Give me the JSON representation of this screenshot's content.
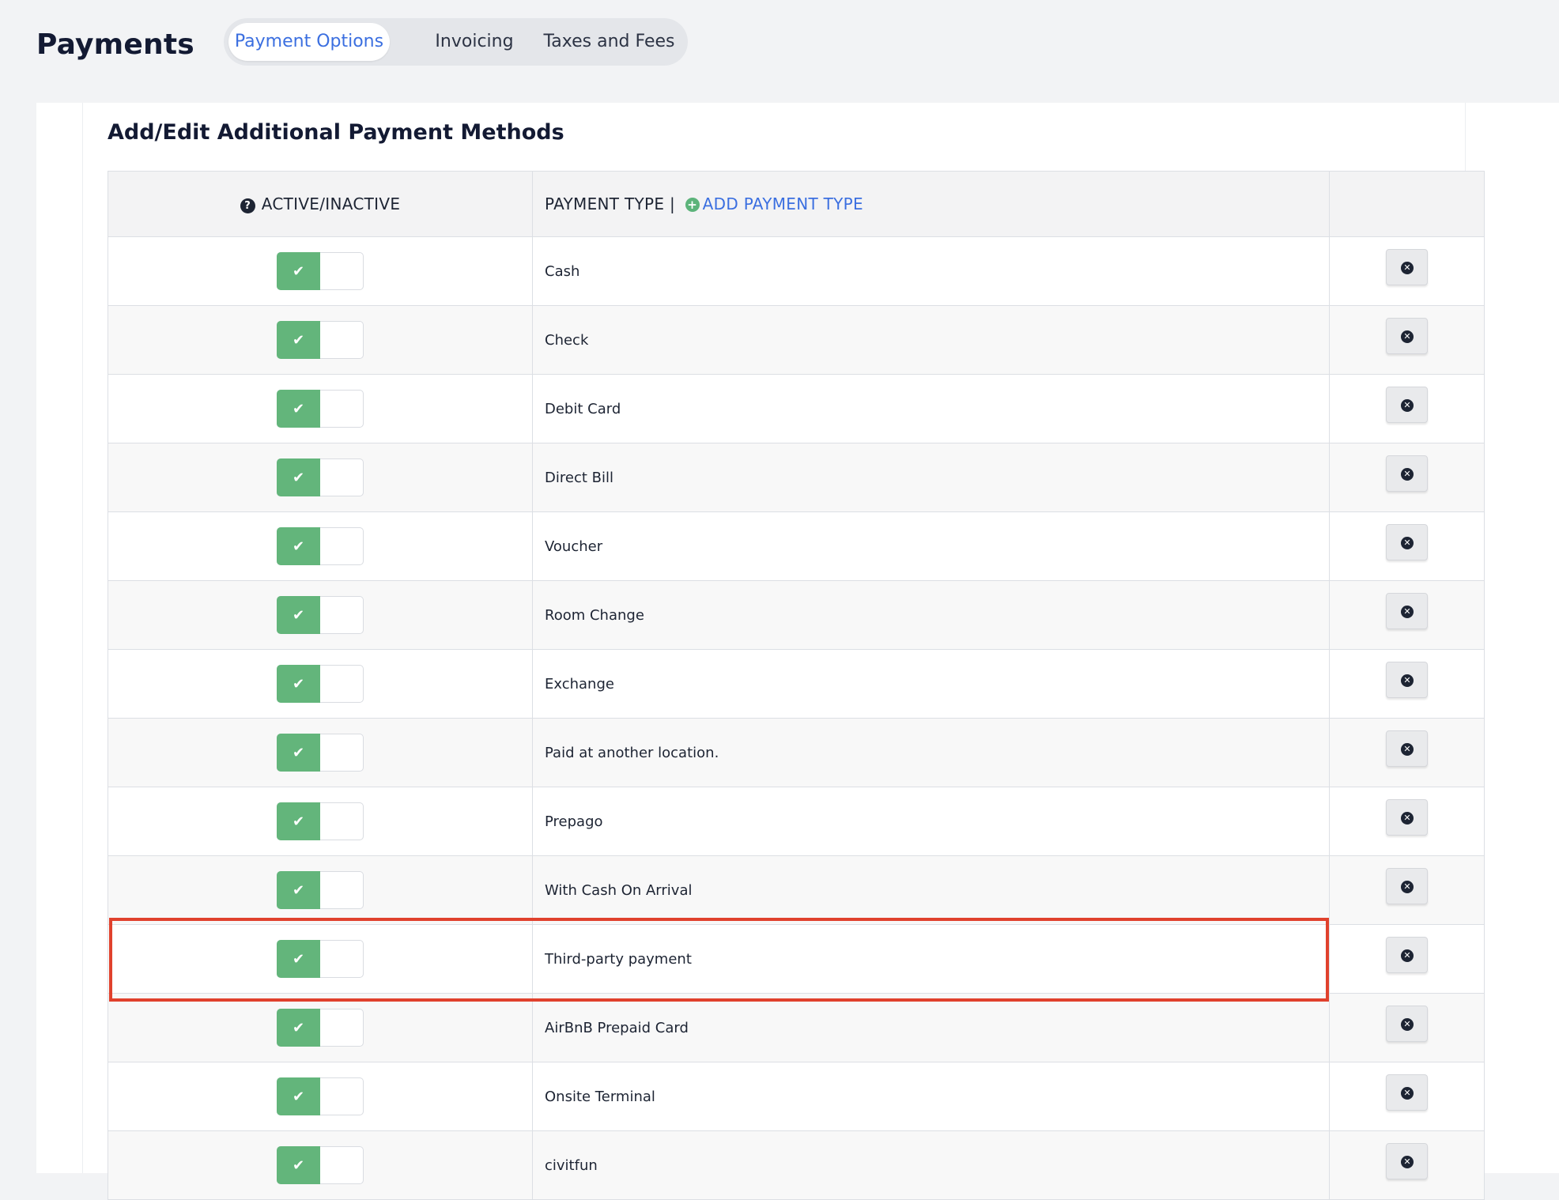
{
  "header": {
    "title": "Payments",
    "tabs": [
      {
        "label": "Payment Options",
        "active": true
      },
      {
        "label": "Invoicing",
        "active": false
      },
      {
        "label": "Taxes and Fees",
        "active": false
      }
    ]
  },
  "section": {
    "title": "Add/Edit Additional Payment Methods",
    "columns": {
      "active": "ACTIVE/INACTIVE",
      "type": "PAYMENT TYPE |",
      "add_type": "ADD PAYMENT TYPE"
    },
    "rows": [
      {
        "name": "Cash",
        "active": true
      },
      {
        "name": "Check",
        "active": true
      },
      {
        "name": "Debit Card",
        "active": true
      },
      {
        "name": "Direct Bill",
        "active": true
      },
      {
        "name": "Voucher",
        "active": true
      },
      {
        "name": "Room Change",
        "active": true
      },
      {
        "name": "Exchange",
        "active": true
      },
      {
        "name": "Paid at another location.",
        "active": true
      },
      {
        "name": "Prepago",
        "active": true
      },
      {
        "name": "With Cash On Arrival",
        "active": true
      },
      {
        "name": "Third-party payment",
        "active": true,
        "highlighted": true
      },
      {
        "name": "AirBnB Prepaid Card",
        "active": true
      },
      {
        "name": "Onsite Terminal",
        "active": true
      },
      {
        "name": "civitfun",
        "active": true
      }
    ]
  },
  "icons": {
    "help": "question-circle-icon",
    "add": "plus-circle-icon",
    "check": "check-icon",
    "delete": "times-circle-icon"
  },
  "colors": {
    "accent": "#3b6fe0",
    "toggle_on": "#63b57b",
    "highlight": "#e0412d"
  }
}
